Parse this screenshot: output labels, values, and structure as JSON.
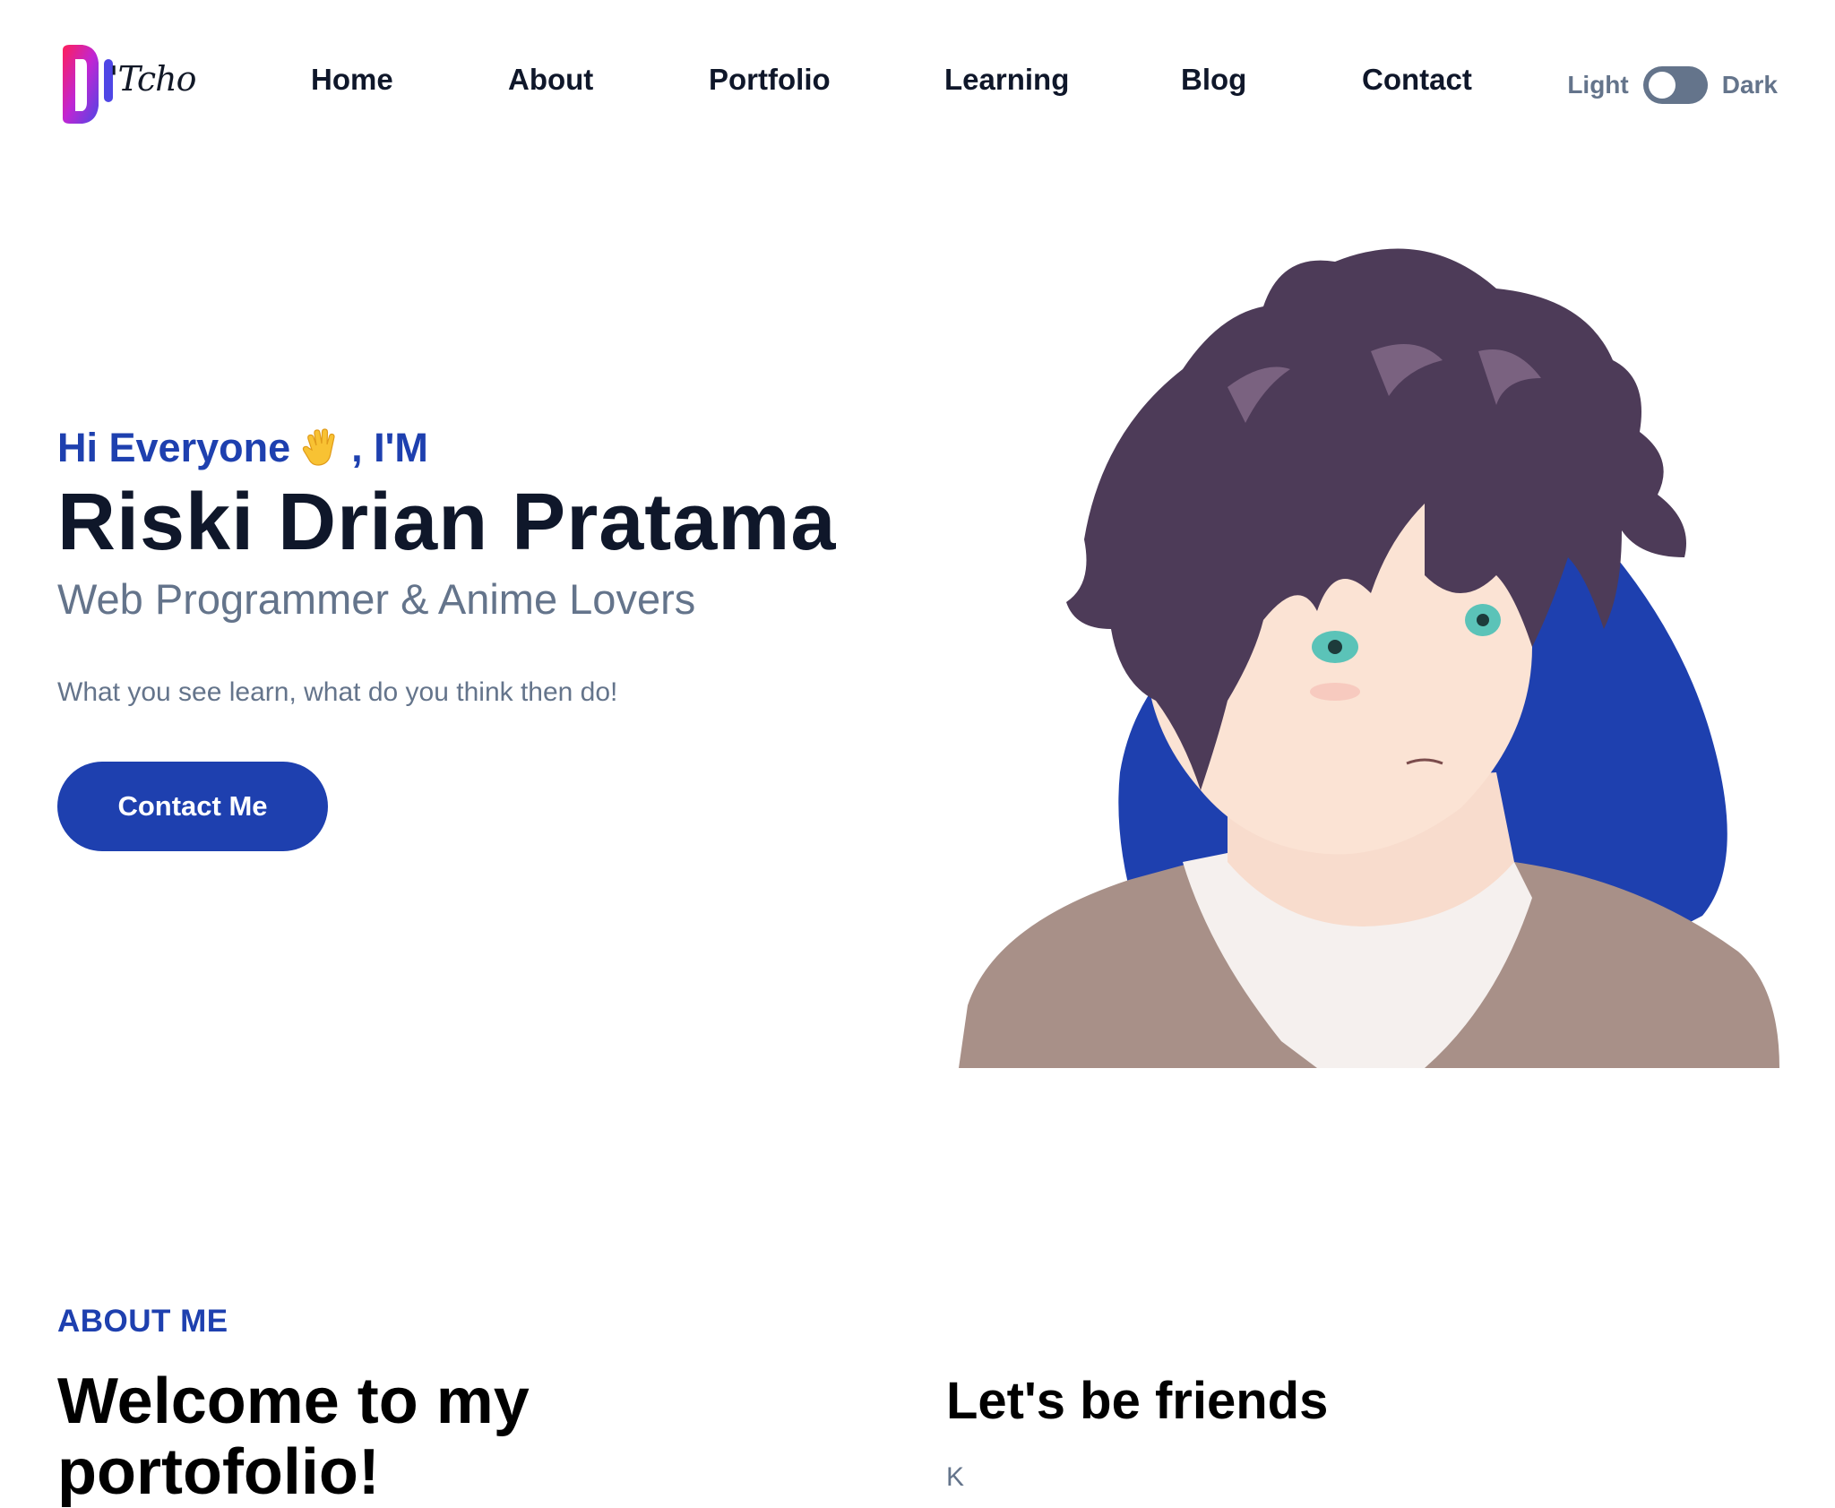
{
  "brand": {
    "logo_text": "'Tcho",
    "logo_icon": "d-logo-icon"
  },
  "nav": {
    "items": [
      {
        "label": "Home"
      },
      {
        "label": "About"
      },
      {
        "label": "Portfolio"
      },
      {
        "label": "Learning"
      },
      {
        "label": "Blog"
      },
      {
        "label": "Contact"
      }
    ]
  },
  "theme_toggle": {
    "light_label": "Light",
    "dark_label": "Dark",
    "state": "light"
  },
  "hero": {
    "greeting_prefix": "Hi Everyone",
    "greeting_icon": "waving-hand-icon",
    "greeting_suffix": ", I'M",
    "name": "Riski Drian Pratama",
    "role": "Web Programmer & Anime Lovers",
    "tagline": "What you see learn, what do you think then do!",
    "cta_label": "Contact Me"
  },
  "about": {
    "kicker": "ABOUT ME",
    "title": "Welcome to my portofolio!",
    "friends_title": "Let's be friends",
    "friends_text": "K"
  },
  "colors": {
    "accent": "#1e40af",
    "text_dark": "#0f172a",
    "muted": "#64748b"
  }
}
